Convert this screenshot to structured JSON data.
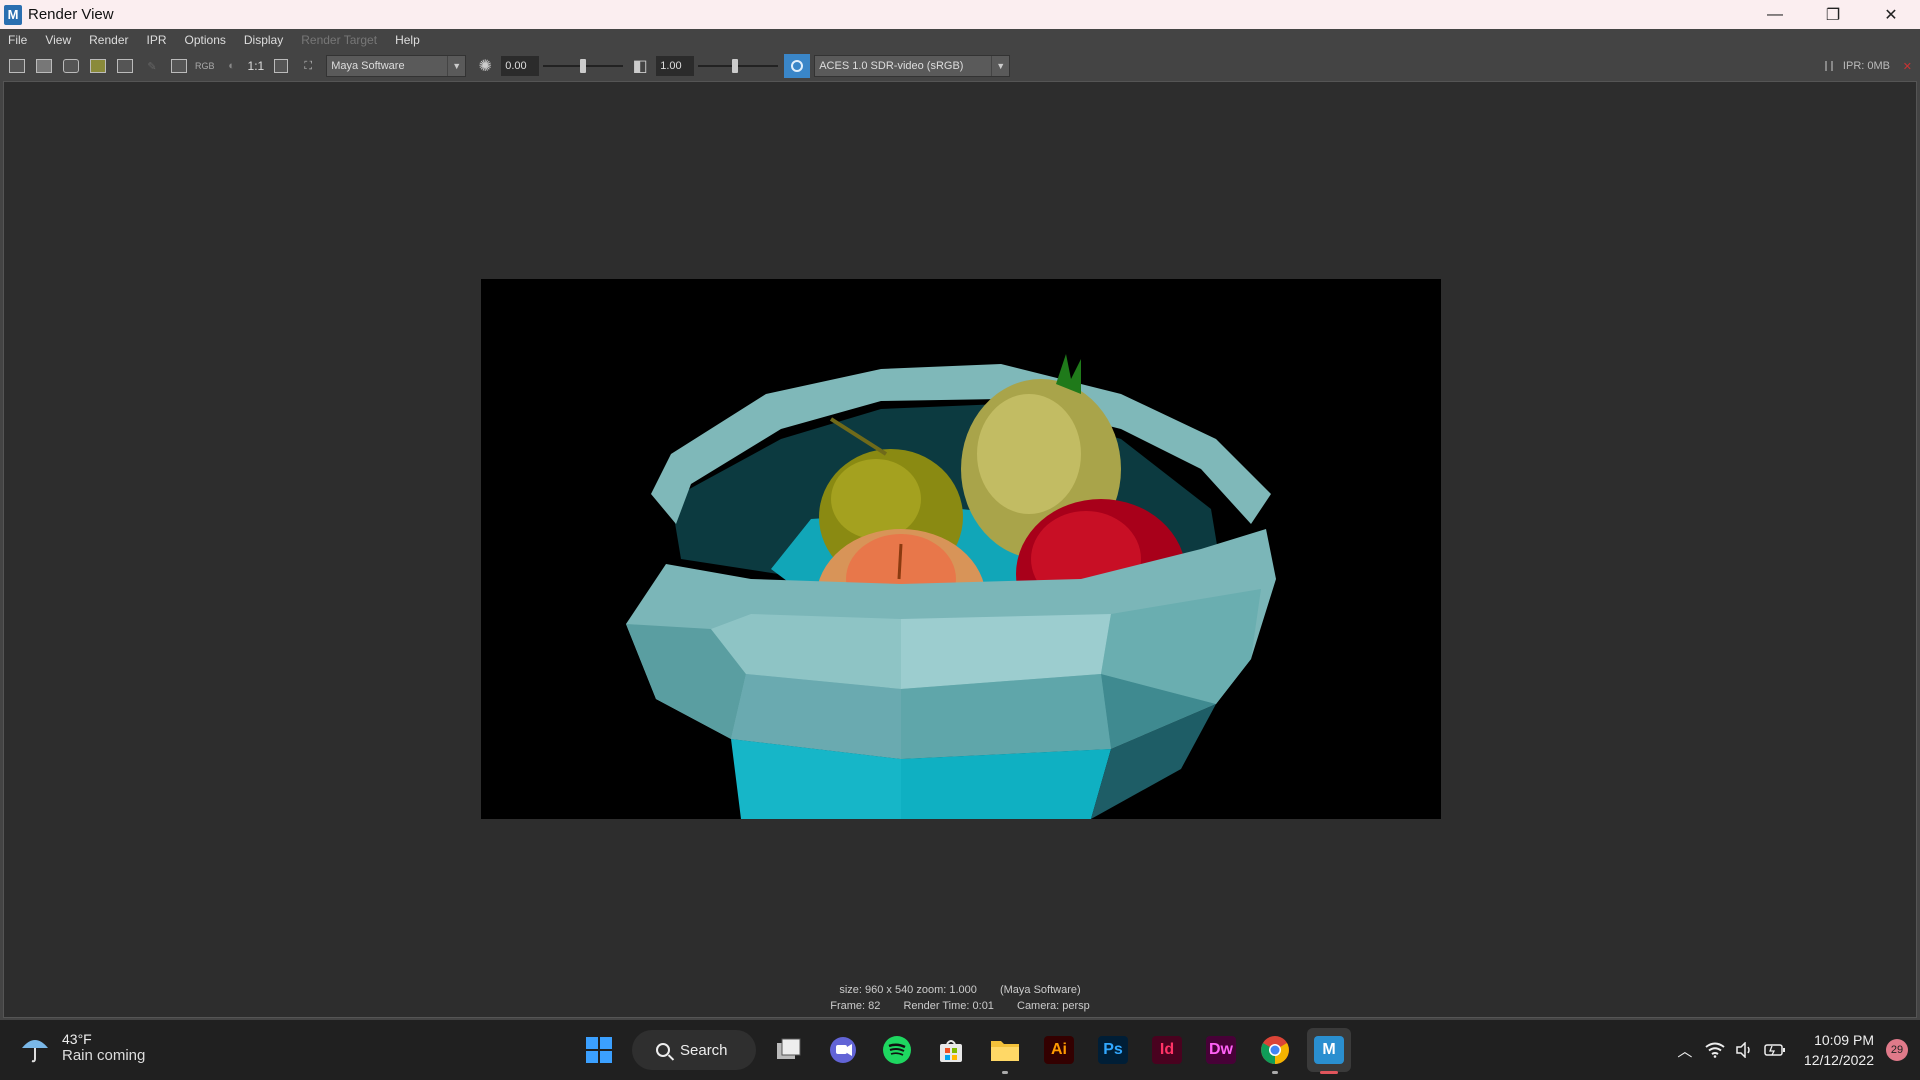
{
  "window": {
    "title": "Render View",
    "app_icon_letter": "M",
    "controls": {
      "minimize": "—",
      "restore": "❐",
      "close": "✕"
    }
  },
  "menubar": {
    "items": [
      {
        "label": "File",
        "disabled": false
      },
      {
        "label": "View",
        "disabled": false
      },
      {
        "label": "Render",
        "disabled": false
      },
      {
        "label": "IPR",
        "disabled": false
      },
      {
        "label": "Options",
        "disabled": false
      },
      {
        "label": "Display",
        "disabled": false
      },
      {
        "label": "Render Target",
        "disabled": true
      },
      {
        "label": "Help",
        "disabled": false
      }
    ]
  },
  "toolbar": {
    "rgb_label": "RGB",
    "one_to_one_label": "1:1",
    "renderer": "Maya Software",
    "exposure_value": "0.00",
    "exposure_slider_fraction": 0.5,
    "gamma_value": "1.00",
    "gamma_slider_fraction": 0.45,
    "view_transform": "ACES 1.0 SDR-video (sRGB)",
    "ipr_memory": "IPR: 0MB"
  },
  "render_info": {
    "size_zoom": "size: 960 x 540 zoom: 1.000",
    "renderer_tag": "(Maya Software)",
    "frame": "Frame: 82",
    "render_time": "Render Time: 0:01",
    "camera": "Camera: persp"
  },
  "taskbar": {
    "weather_temp": "43°F",
    "weather_desc": "Rain coming",
    "search_label": "Search",
    "apps": [
      {
        "name": "ai",
        "label": "Ai",
        "bg": "#330000",
        "fg": "#ff9a00"
      },
      {
        "name": "ps",
        "label": "Ps",
        "bg": "#001e36",
        "fg": "#31a8ff"
      },
      {
        "name": "id",
        "label": "Id",
        "bg": "#49021f",
        "fg": "#ff3366"
      },
      {
        "name": "dw",
        "label": "Dw",
        "bg": "#470137",
        "fg": "#ff61f6"
      }
    ],
    "time": "10:09 PM",
    "date": "12/12/2022",
    "notification_count": "29"
  },
  "colors": {
    "accent_ocio": "#3a86c8",
    "active_indicator": "#e0555c"
  }
}
